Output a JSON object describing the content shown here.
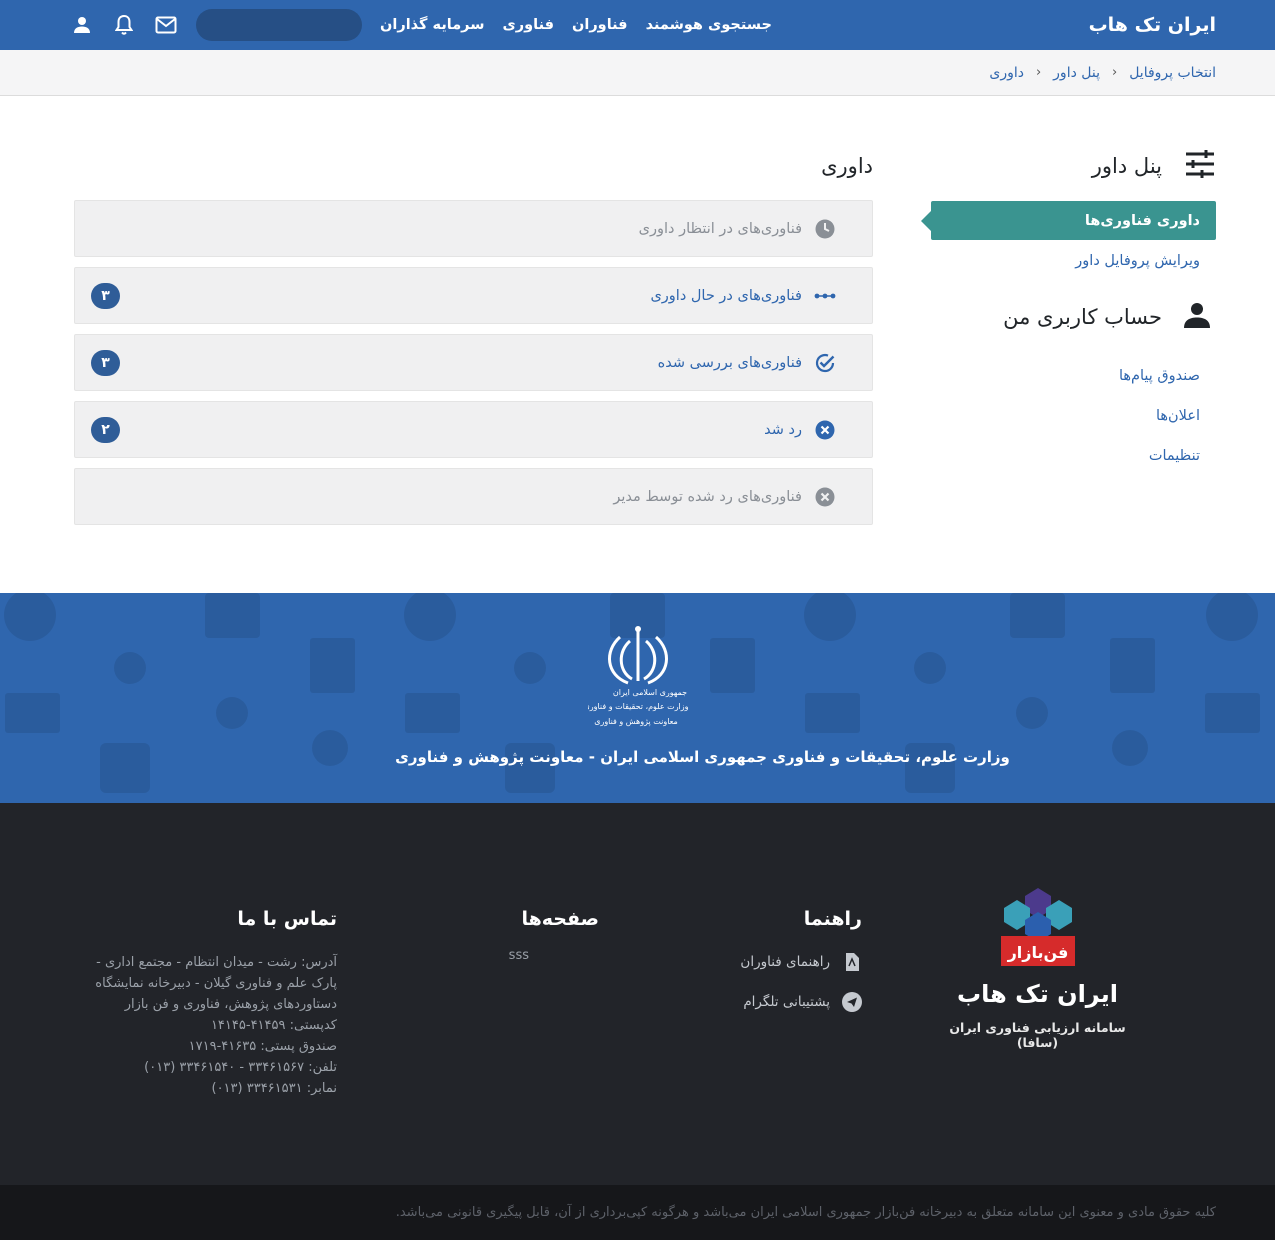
{
  "nav": {
    "brand": "ایران تک هاب",
    "links": [
      "جستجوی هوشمند",
      "فناوران",
      "فناوری",
      "سرمایه گذاران"
    ],
    "icons": [
      "mail-icon",
      "bell-icon",
      "user-icon"
    ],
    "accent": "#2f66ae"
  },
  "breadcrumb": [
    "انتخاب پروفایل",
    "پنل داور",
    "داوری"
  ],
  "sidebar": {
    "panel_title": "پنل داور",
    "panel_items": [
      {
        "label": "داوری فناوری‌ها",
        "active": true
      },
      {
        "label": "ویرایش پروفایل داور",
        "active": false
      }
    ],
    "account_title": "حساب کاربری من",
    "account_items": [
      {
        "label": "صندوق پیام‌ها"
      },
      {
        "label": "اعلان‌ها"
      },
      {
        "label": "تنظیمات"
      }
    ],
    "active_color": "#3a9490"
  },
  "content": {
    "title": "داوری",
    "rows": [
      {
        "label": "فناوری‌های در انتظار داوری",
        "icon": "clock-icon",
        "count": ""
      },
      {
        "label": "فناوری‌های در حال داوری",
        "icon": "dots-icon",
        "count": "۳"
      },
      {
        "label": "فناوری‌های بررسی شده",
        "icon": "check-circle-icon",
        "count": "۳"
      },
      {
        "label": "رد شد",
        "icon": "x-circle-icon",
        "count": "۲"
      },
      {
        "label": "فناوری‌های رد شده توسط مدیر",
        "icon": "x-circle-icon",
        "count": ""
      }
    ]
  },
  "band": {
    "text": "وزارت علوم، تحقیقات و فناوری جمهوری اسلامی ایران - معاونت پژوهش و فناوری",
    "emblem_lines": [
      "جمهوری اسلامی ایران",
      "وزارت علوم، تحقیقات و فناوری",
      "معاونت پژوهش و فناوری"
    ]
  },
  "footer": {
    "brand": "ایران تک هاب",
    "brand_sub": "سامانه ارزیابی فناوری ایران (سافا)",
    "logo_text": "فن‌بازار",
    "guide_title": "راهنما",
    "guide_links": [
      {
        "label": "راهنمای فناوران",
        "icon": "pdf-icon"
      },
      {
        "label": "پشتیبانی تلگرام",
        "icon": "telegram-icon"
      }
    ],
    "pages_title": "صفحه‌ها",
    "pages_links": [
      "sss"
    ],
    "contact_title": "تماس با ما",
    "contact_lines": [
      "آدرس: رشت - میدان انتظام - مجتمع اداری -",
      "پارک علم و فناوری گیلان - دبیرخانه نمایشگاه",
      "دستاوردهای پژوهش، فناوری و فن بازار",
      "کدپستی: ۴۱۴۵۹-۱۴۱۴۵",
      "صندوق پستی: ۴۱۶۳۵-۱۷۱۹",
      "تلفن: ۳۳۴۶۱۵۶۷ - ۳۳۴۶۱۵۴۰ (۰۱۳)",
      "نمابر: ۳۳۴۶۱۵۳۱ (۰۱۳)"
    ],
    "copyright": "کلیه حقوق مادی و معنوی این سامانه متعلق به دبیرخانه فن‌بازار جمهوری اسلامی ایران می‌باشد و هرگونه کپی‌برداری از آن، قابل پیگیری قانونی می‌باشد."
  }
}
